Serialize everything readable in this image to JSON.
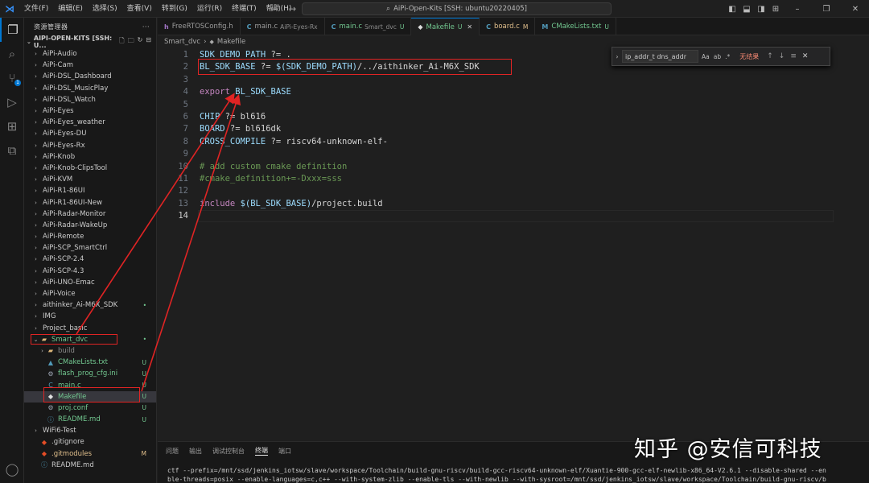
{
  "titlebar": {
    "menu": [
      "文件(F)",
      "编辑(E)",
      "选择(S)",
      "查看(V)",
      "转到(G)",
      "运行(R)",
      "终端(T)",
      "帮助(H)"
    ],
    "command_center": "AiPi-Open-Kits [SSH: ubuntu20220405]"
  },
  "sidebar": {
    "header": "资源管理器",
    "root": "AIPI-OPEN-KITS [SSH: U...",
    "items": [
      {
        "label": "AiPi-Audio",
        "type": "folder",
        "indent": 1,
        "expanded": false
      },
      {
        "label": "AiPi-Cam",
        "type": "folder",
        "indent": 1,
        "expanded": false
      },
      {
        "label": "AiPi-DSL_Dashboard",
        "type": "folder",
        "indent": 1,
        "expanded": false
      },
      {
        "label": "AiPi-DSL_MusicPlay",
        "type": "folder",
        "indent": 1,
        "expanded": false
      },
      {
        "label": "AiPi-DSL_Watch",
        "type": "folder",
        "indent": 1,
        "expanded": false
      },
      {
        "label": "AiPi-Eyes",
        "type": "folder",
        "indent": 1,
        "expanded": false
      },
      {
        "label": "AiPi-Eyes_weather",
        "type": "folder",
        "indent": 1,
        "expanded": false
      },
      {
        "label": "AiPi-Eyes-DU",
        "type": "folder",
        "indent": 1,
        "expanded": false
      },
      {
        "label": "AiPi-Eyes-Rx",
        "type": "folder",
        "indent": 1,
        "expanded": false
      },
      {
        "label": "AiPi-Knob",
        "type": "folder",
        "indent": 1,
        "expanded": false
      },
      {
        "label": "AiPi-Knob-ClipsTool",
        "type": "folder",
        "indent": 1,
        "expanded": false
      },
      {
        "label": "AiPi-KVM",
        "type": "folder",
        "indent": 1,
        "expanded": false
      },
      {
        "label": "AiPi-R1-86UI",
        "type": "folder",
        "indent": 1,
        "expanded": false
      },
      {
        "label": "AiPi-R1-86UI-New",
        "type": "folder",
        "indent": 1,
        "expanded": false
      },
      {
        "label": "AiPi-Radar-Monitor",
        "type": "folder",
        "indent": 1,
        "expanded": false
      },
      {
        "label": "AiPi-Radar-WakeUp",
        "type": "folder",
        "indent": 1,
        "expanded": false
      },
      {
        "label": "AiPi-Remote",
        "type": "folder",
        "indent": 1,
        "expanded": false
      },
      {
        "label": "AiPi-SCP_SmartCtrl",
        "type": "folder",
        "indent": 1,
        "expanded": false
      },
      {
        "label": "AiPi-SCP-2.4",
        "type": "folder",
        "indent": 1,
        "expanded": false
      },
      {
        "label": "AiPi-SCP-4.3",
        "type": "folder",
        "indent": 1,
        "expanded": false
      },
      {
        "label": "AiPi-UNO-Emac",
        "type": "folder",
        "indent": 1,
        "expanded": false
      },
      {
        "label": "AiPi-Voice",
        "type": "folder",
        "indent": 1,
        "expanded": false
      },
      {
        "label": "aithinker_Ai-M6X_SDK",
        "type": "folder",
        "indent": 1,
        "expanded": false,
        "status": "•",
        "status_color": "#73c991"
      },
      {
        "label": "IMG",
        "type": "folder",
        "indent": 1,
        "expanded": false
      },
      {
        "label": "Project_basic",
        "type": "folder",
        "indent": 1,
        "expanded": false
      },
      {
        "label": "Smart_dvc",
        "type": "folder-open",
        "indent": 1,
        "expanded": true,
        "status": "•",
        "status_color": "#73c991",
        "label_color": "#73c991"
      },
      {
        "label": "build",
        "type": "folder",
        "indent": 2,
        "expanded": false,
        "label_color": "#8a8a8a"
      },
      {
        "label": "CMakeLists.txt",
        "type": "cmake",
        "indent": 2,
        "status": "U",
        "status_color": "#73c991",
        "label_color": "#73c991"
      },
      {
        "label": "flash_prog_cfg.ini",
        "type": "gear",
        "indent": 2,
        "status": "U",
        "status_color": "#73c991",
        "label_color": "#73c991"
      },
      {
        "label": "main.c",
        "type": "c",
        "indent": 2,
        "status": "U",
        "status_color": "#73c991",
        "label_color": "#73c991"
      },
      {
        "label": "Makefile",
        "type": "makefile",
        "indent": 2,
        "status": "U",
        "status_color": "#73c991",
        "label_color": "#73c991",
        "selected": true
      },
      {
        "label": "proj.conf",
        "type": "gear",
        "indent": 2,
        "status": "U",
        "status_color": "#73c991",
        "label_color": "#73c991"
      },
      {
        "label": "README.md",
        "type": "md",
        "indent": 2,
        "status": "U",
        "status_color": "#73c991",
        "label_color": "#73c991"
      },
      {
        "label": "WiFi6-Test",
        "type": "folder",
        "indent": 1,
        "expanded": false
      },
      {
        "label": ".gitignore",
        "type": "git",
        "indent": 1
      },
      {
        "label": ".gitmodules",
        "type": "git",
        "indent": 1,
        "status": "M",
        "status_color": "#e2c08d",
        "label_color": "#e2c08d"
      },
      {
        "label": "README.md",
        "type": "md",
        "indent": 1
      }
    ]
  },
  "tabs": [
    {
      "icon": "h",
      "icon_color": "#a074c4",
      "label": "FreeRTOSConfig.h",
      "desc": "",
      "mod": "",
      "active": false
    },
    {
      "icon": "C",
      "icon_color": "#519aba",
      "label": "main.c",
      "desc": "AiPi-Eyes-Rx",
      "mod": "",
      "active": false
    },
    {
      "icon": "C",
      "icon_color": "#519aba",
      "label": "main.c",
      "desc": "Smart_dvc",
      "mod": "U",
      "mod_color": "#73c991",
      "label_color": "#73c991",
      "active": false
    },
    {
      "icon": "◆",
      "icon_color": "#dddddd",
      "label": "Makefile",
      "desc": "",
      "mod": "U",
      "mod_color": "#73c991",
      "label_color": "#73c991",
      "active": true
    },
    {
      "icon": "C",
      "icon_color": "#519aba",
      "label": "board.c",
      "desc": "",
      "mod": "M",
      "mod_color": "#e2c08d",
      "label_color": "#e2c08d",
      "active": false
    },
    {
      "icon": "M",
      "icon_color": "#519aba",
      "label": "CMakeLists.txt",
      "desc": "",
      "mod": "U",
      "mod_color": "#73c991",
      "label_color": "#73c991",
      "active": false
    }
  ],
  "breadcrumb": [
    "Smart_dvc",
    "Makefile"
  ],
  "editor": {
    "line_numbers": [
      "1",
      "2",
      "3",
      "4",
      "5",
      "6",
      "7",
      "8",
      "9",
      "10",
      "11",
      "12",
      "13",
      "14"
    ],
    "lines": [
      [
        [
          "SDK_DEMO_PATH",
          "var"
        ],
        [
          " ?= .",
          "op"
        ]
      ],
      [
        [
          "BL_SDK_BASE",
          "var"
        ],
        [
          " ?= ",
          "op"
        ],
        [
          "$(SDK_DEMO_PATH)",
          "var"
        ],
        [
          "/../aithinker_Ai-M6X_SDK",
          "op"
        ]
      ],
      [],
      [
        [
          "export ",
          "kw"
        ],
        [
          "BL_SDK_BASE",
          "var"
        ]
      ],
      [],
      [
        [
          "CHIP",
          "var"
        ],
        [
          " ?= ",
          "op"
        ],
        [
          "bl616",
          "op"
        ]
      ],
      [
        [
          "BOARD",
          "var"
        ],
        [
          " ?= ",
          "op"
        ],
        [
          "bl616dk",
          "op"
        ]
      ],
      [
        [
          "CROSS_COMPILE",
          "var"
        ],
        [
          " ?= ",
          "op"
        ],
        [
          "riscv64-unknown-elf-",
          "op"
        ]
      ],
      [],
      [
        [
          "# add custom cmake definition",
          "com"
        ]
      ],
      [
        [
          "#cmake_definition+=-Dxxx=sss",
          "com"
        ]
      ],
      [],
      [
        [
          "include ",
          "kw"
        ],
        [
          "$(BL_SDK_BASE)",
          "var"
        ],
        [
          "/project.build",
          "op"
        ]
      ],
      []
    ]
  },
  "find": {
    "query": "ip_addr_t dns_addr",
    "options": [
      "Aa",
      "ab",
      ".*"
    ],
    "result": "无结果"
  },
  "panel": {
    "tabs": [
      "问题",
      "输出",
      "调试控制台",
      "终端",
      "端口"
    ],
    "active_tab": "终端",
    "terminal_lines": [
      "ctf --prefix=/mnt/ssd/jenkins_iotsw/slave/workspace/Toolchain/build-gnu-riscv/build-gcc-riscv64-unknown-elf/Xuantie-900-gcc-elf-newlib-x86_64-V2.6.1 --disable-shared --en",
      "ble-threads=posix --enable-languages=c,c++ --with-system-zlib --enable-tls --with-newlib --with-sysroot=/mnt/ssd/jenkins_iotsw/slave/workspace/Toolchain/build-gnu-riscv/b"
    ]
  },
  "watermark": "知乎 @安信可科技"
}
